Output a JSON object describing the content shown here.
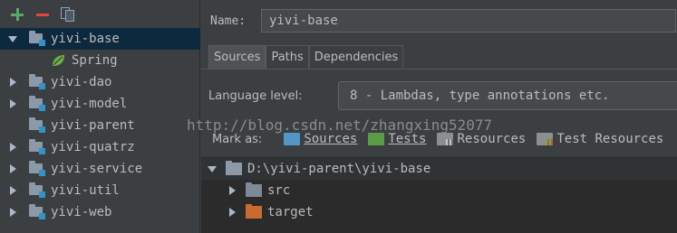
{
  "toolbar": {
    "add_icon": "plus-icon",
    "remove_icon": "minus-icon",
    "copy_icon": "copy-icon"
  },
  "tree": {
    "items": [
      {
        "label": "yivi-base",
        "expanded": true,
        "selected": true
      },
      {
        "label": "Spring"
      },
      {
        "label": "yivi-dao"
      },
      {
        "label": "yivi-model"
      },
      {
        "label": "yivi-parent"
      },
      {
        "label": "yivi-quatrz"
      },
      {
        "label": "yivi-service"
      },
      {
        "label": "yivi-util"
      },
      {
        "label": "yivi-web"
      }
    ]
  },
  "name_field": {
    "label": "Name:",
    "value": "yivi-base"
  },
  "tabs": [
    {
      "label": "Sources",
      "active": true
    },
    {
      "label": "Paths"
    },
    {
      "label": "Dependencies"
    }
  ],
  "language_level": {
    "label": "Language level:",
    "value": "8 - Lambdas, type annotations etc."
  },
  "watermark": "http://blog.csdn.net/zhangxing52077",
  "mark_as": {
    "label": "Mark as:",
    "options": [
      {
        "label": "Sources",
        "color": "#5196c4"
      },
      {
        "label": "Tests",
        "color": "#5a9b45"
      },
      {
        "label": "Resources"
      },
      {
        "label": "Test Resources"
      }
    ]
  },
  "content_root": {
    "path": "D:\\yivi-parent\\yivi-base",
    "children": [
      {
        "label": "src"
      },
      {
        "label": "target",
        "color": "#c96b2e"
      }
    ]
  }
}
